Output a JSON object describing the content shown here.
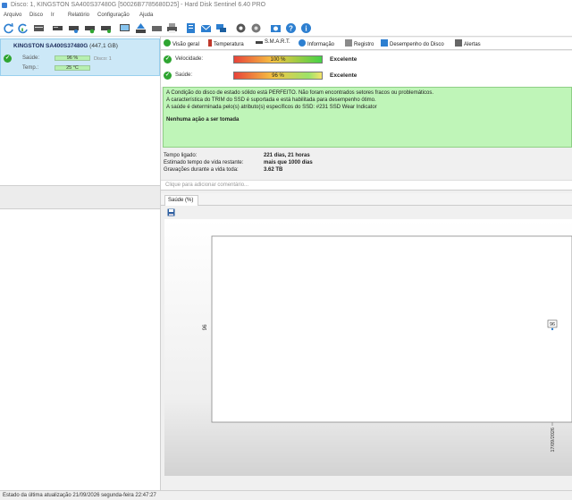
{
  "window": {
    "title": "Disco: 1, KINGSTON SA400S37480G [50026B7785680D25]  -  Hard Disk Sentinel 6.40 PRO"
  },
  "menu": [
    "Arquivo",
    "Disco",
    "Ir",
    "Relatório",
    "Configuração",
    "Ajuda"
  ],
  "toolbar_icons": [
    "refresh-icon",
    "refresh-all-icon",
    "disk-icon",
    "disk-gray-icon",
    "disk-gray-icon",
    "disk-check-icon",
    "disk-green-icon",
    "disk-gray-icon",
    "monitor-icon",
    "disk-up-icon",
    "disk-gray-icon",
    "printer-icon",
    "notes-icon",
    "mail-icon",
    "messages-icon",
    "settings-icon",
    "settings-gear-icon",
    "camera-icon",
    "help-icon",
    "info-icon"
  ],
  "disk": {
    "name": "KINGSTON SA400S37480G",
    "capacity": "(447,1 GB)",
    "health_label": "Saúde:",
    "health_value": "96 %",
    "temp_label": "Temp.:",
    "temp_value": "25 °C",
    "disk_label": "Disco: 1"
  },
  "tabs": [
    "Visão geral",
    "Temperatura",
    "S.M.A.R.T.",
    "Informação",
    "Registro",
    "Desempenho do Disco",
    "Alertas"
  ],
  "status": {
    "performance_label": "Velocidade:",
    "performance_value": "100 %",
    "performance_percent": 100,
    "performance_rating": "Excelente",
    "health_label": "Saúde:",
    "health_value": "96 %",
    "health_percent": 96,
    "health_rating": "Excelente"
  },
  "info": {
    "line1": "A Condição do disco de estado sólido está PERFEITO. Não foram encontrados setores fracos ou problemáticos.",
    "line2": "A característica do TRIM do SSD é suportada e está habilitada para desempenho ótimo.",
    "line3": "A saúde é determinada pelo(s) atributo(s) específicos do SSD: #231 SSD Wear Indicator",
    "action": "Nenhuma ação a ser tomada"
  },
  "stats": {
    "power_on_label": "Tempo ligado:",
    "power_on_value": "221 dias, 21 horas",
    "remaining_label": "Estimado tempo de vida restante:",
    "remaining_value": "mais que 1000 dias",
    "written_label": "Gravações durante a vida toda:",
    "written_value": "3.62 TB"
  },
  "comment_placeholder": "Clique para adicionar  comentário...",
  "chart_tab": "Saúde (%)",
  "chart_data": {
    "type": "line",
    "x": [
      "17/09/2026"
    ],
    "series": [
      {
        "values": [
          96
        ]
      }
    ],
    "y_tick_labels": [
      "96"
    ],
    "point_labels": [
      "96"
    ],
    "ylim": [
      95,
      97
    ]
  },
  "statusbar": {
    "text": "Estado da última atualização 21/09/2026 segunda-feira 22:47:27"
  }
}
